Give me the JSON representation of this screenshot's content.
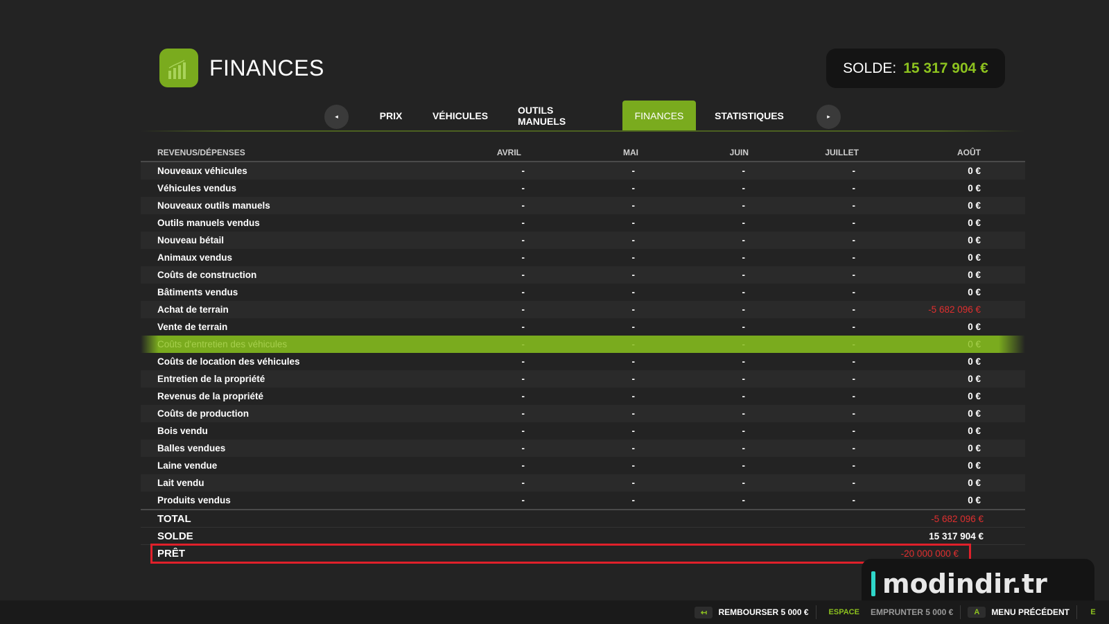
{
  "header": {
    "title": "FINANCES",
    "balance_label": "SOLDE:",
    "balance_value": "15 317 904 €"
  },
  "tabs": [
    {
      "label": "PRIX"
    },
    {
      "label": "VÉHICULES"
    },
    {
      "label": "OUTILS MANUELS"
    },
    {
      "label": "FINANCES",
      "active": true
    },
    {
      "label": "STATISTIQUES"
    }
  ],
  "icons": {
    "prev": "◂",
    "next": "▸"
  },
  "table": {
    "columns": [
      "REVENUS/DÉPENSES",
      "AVRIL",
      "MAI",
      "JUIN",
      "JUILLET",
      "AOÛT"
    ],
    "rows": [
      {
        "label": "Nouveaux véhicules",
        "values": [
          "-",
          "-",
          "-",
          "-",
          "0 €"
        ]
      },
      {
        "label": "Véhicules vendus",
        "values": [
          "-",
          "-",
          "-",
          "-",
          "0 €"
        ]
      },
      {
        "label": "Nouveaux outils manuels",
        "values": [
          "-",
          "-",
          "-",
          "-",
          "0 €"
        ]
      },
      {
        "label": "Outils manuels vendus",
        "values": [
          "-",
          "-",
          "-",
          "-",
          "0 €"
        ]
      },
      {
        "label": "Nouveau bétail",
        "values": [
          "-",
          "-",
          "-",
          "-",
          "0 €"
        ]
      },
      {
        "label": "Animaux vendus",
        "values": [
          "-",
          "-",
          "-",
          "-",
          "0 €"
        ]
      },
      {
        "label": "Coûts de construction",
        "values": [
          "-",
          "-",
          "-",
          "-",
          "0 €"
        ]
      },
      {
        "label": "Bâtiments vendus",
        "values": [
          "-",
          "-",
          "-",
          "-",
          "0 €"
        ]
      },
      {
        "label": "Achat de terrain",
        "values": [
          "-",
          "-",
          "-",
          "-",
          "-5 682 096 €"
        ],
        "negative": true
      },
      {
        "label": "Vente de terrain",
        "values": [
          "-",
          "-",
          "-",
          "-",
          "0 €"
        ]
      },
      {
        "label": "Coûts d'entretien des véhicules",
        "values": [
          "-",
          "-",
          "-",
          "-",
          "0 €"
        ],
        "highlight": true
      },
      {
        "label": "Coûts de location des véhicules",
        "values": [
          "-",
          "-",
          "-",
          "-",
          "0 €"
        ]
      },
      {
        "label": "Entretien de la propriété",
        "values": [
          "-",
          "-",
          "-",
          "-",
          "0 €"
        ]
      },
      {
        "label": "Revenus de la propriété",
        "values": [
          "-",
          "-",
          "-",
          "-",
          "0 €"
        ]
      },
      {
        "label": "Coûts de production",
        "values": [
          "-",
          "-",
          "-",
          "-",
          "0 €"
        ]
      },
      {
        "label": "Bois vendu",
        "values": [
          "-",
          "-",
          "-",
          "-",
          "0 €"
        ]
      },
      {
        "label": "Balles vendues",
        "values": [
          "-",
          "-",
          "-",
          "-",
          "0 €"
        ]
      },
      {
        "label": "Laine vendue",
        "values": [
          "-",
          "-",
          "-",
          "-",
          "0 €"
        ]
      },
      {
        "label": "Lait vendu",
        "values": [
          "-",
          "-",
          "-",
          "-",
          "0 €"
        ]
      },
      {
        "label": "Produits vendus",
        "values": [
          "-",
          "-",
          "-",
          "-",
          "0 €"
        ]
      }
    ]
  },
  "totals": [
    {
      "label": "TOTAL",
      "value": "-5 682 096 €",
      "negative": true
    },
    {
      "label": "SOLDE",
      "value": "15 317 904 €",
      "negative": false
    },
    {
      "label": "PRÊT",
      "value": "-20 000 000 €",
      "negative": true,
      "boxed": true
    }
  ],
  "watermark": "modindir.tr",
  "bottombar": [
    {
      "key": "↤",
      "label": "REMBOURSER 5 000 €"
    },
    {
      "key": "ESPACE",
      "label": "EMPRUNTER 5 000 €",
      "dim": true
    },
    {
      "key": "A",
      "label": "MENU PRÉCÉDENT"
    },
    {
      "key": "E",
      "label": ""
    }
  ],
  "colors": {
    "accent": "#7aab1e",
    "balance": "#8dc21f",
    "negative": "#e02f2f",
    "background": "#232323",
    "outline": "#e0202a"
  }
}
